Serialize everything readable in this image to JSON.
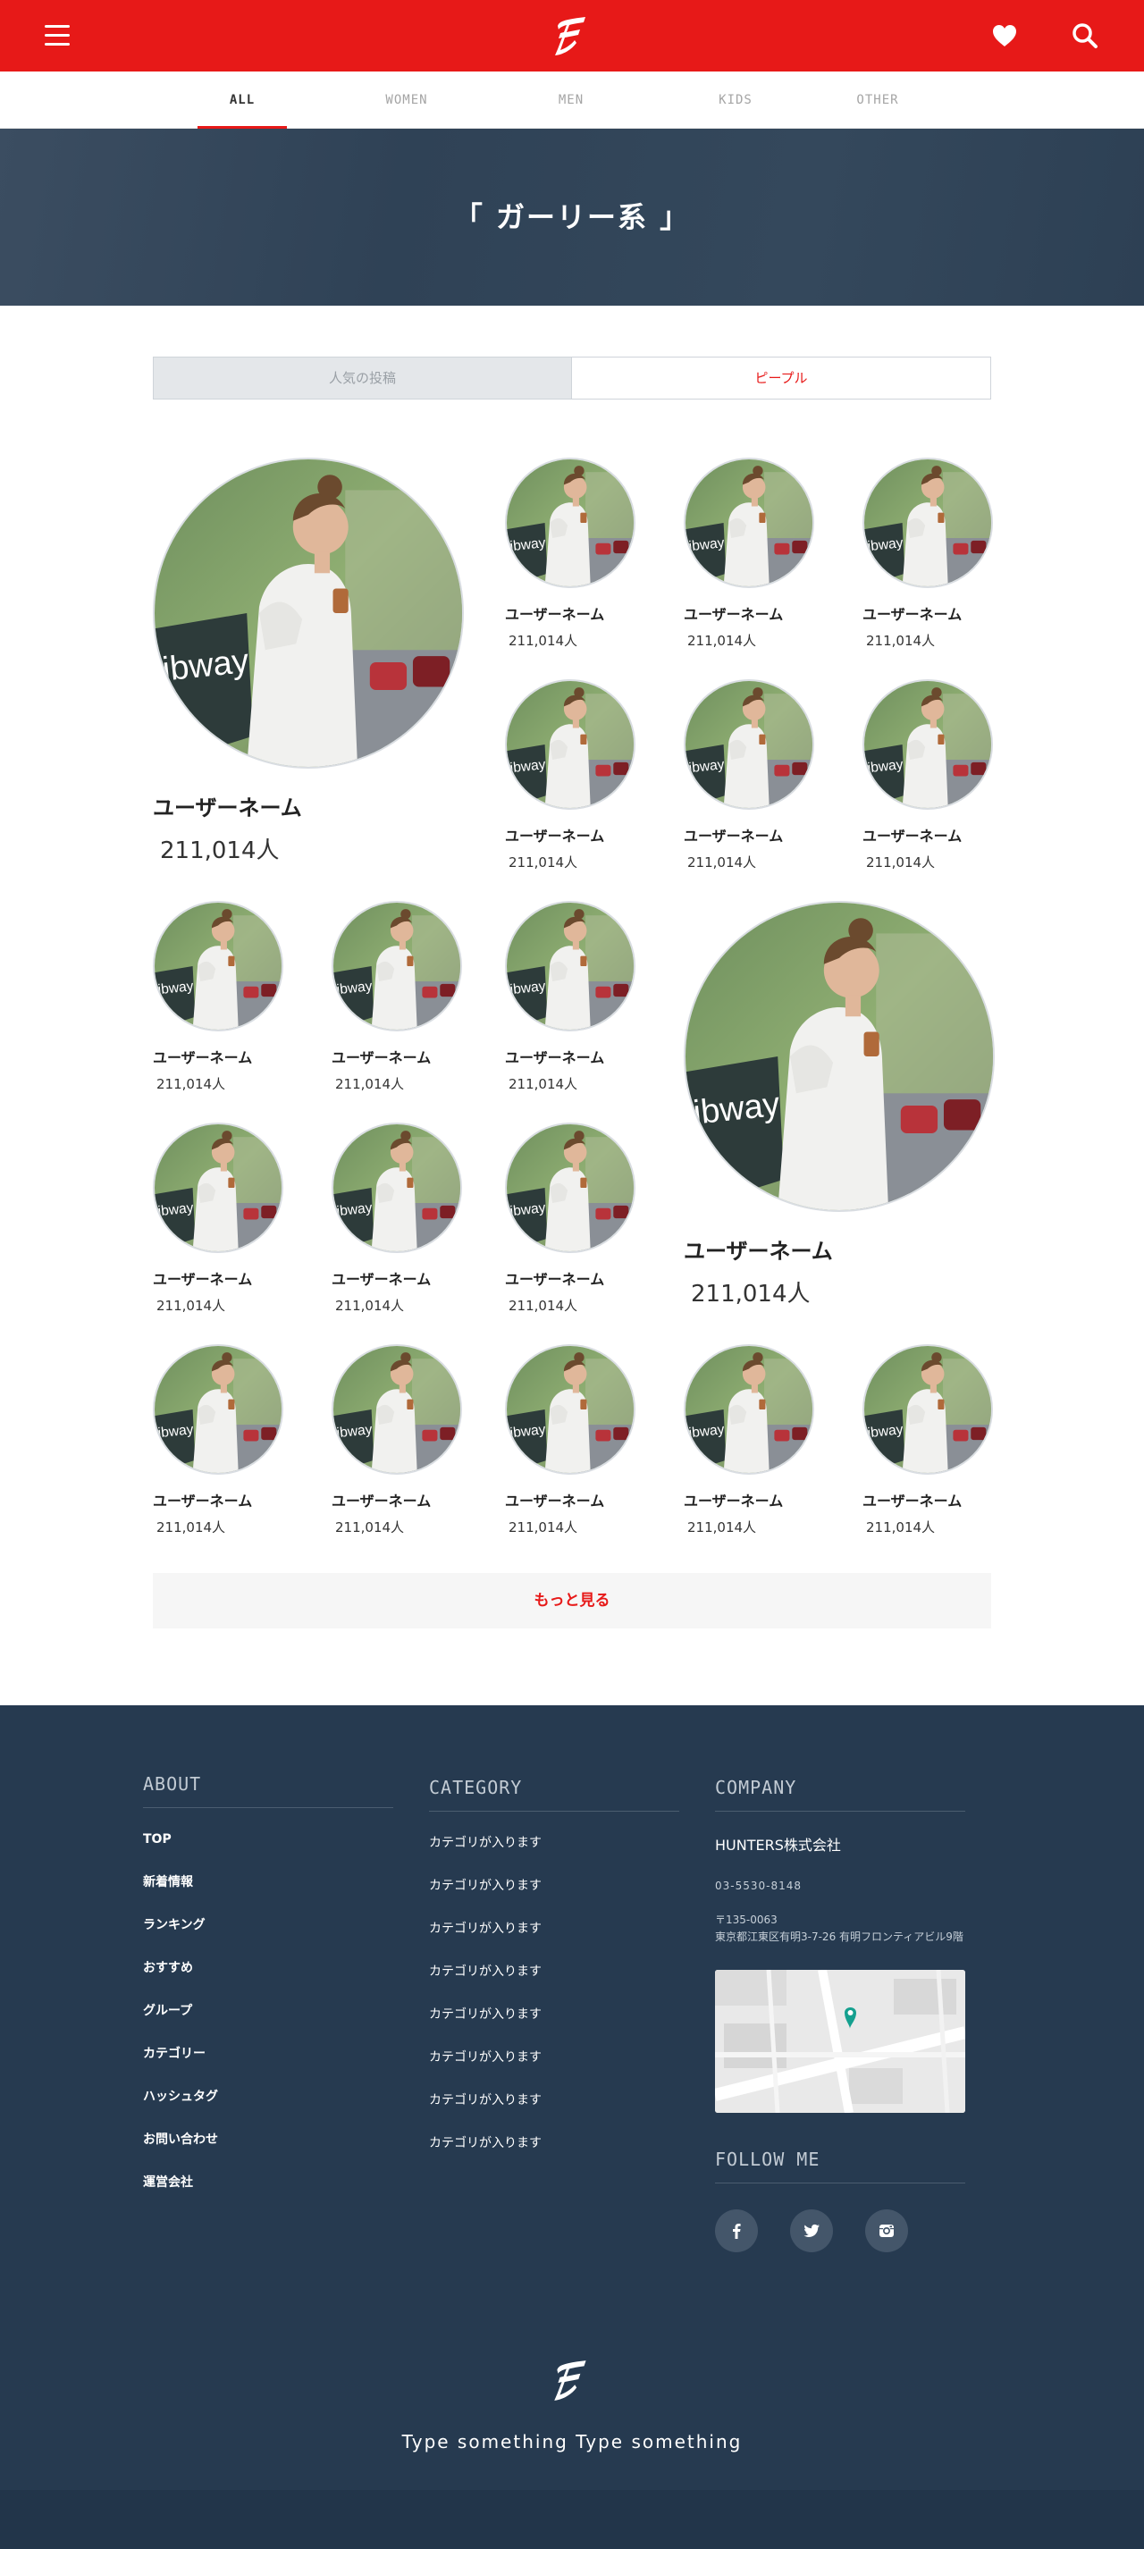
{
  "header": {
    "menu_icon": "hamburger-icon",
    "logo_icon": "brand-logo",
    "favorite_icon": "heart-icon",
    "search_icon": "search-icon",
    "accent_color": "#e71918"
  },
  "tabs": [
    {
      "label": "ALL",
      "active": true
    },
    {
      "label": "WOMEN",
      "active": false
    },
    {
      "label": "MEN",
      "active": false
    },
    {
      "label": "KIDS",
      "active": false
    },
    {
      "label": "OTHER",
      "active": false
    }
  ],
  "hero": {
    "title": "「 ガーリー系 」"
  },
  "switch": {
    "popular_label": "人気の投稿",
    "people_label": "ピープル",
    "active": "people"
  },
  "people": [
    {
      "name": "ユーザーネーム",
      "count": "211,014人",
      "size": "large"
    },
    {
      "name": "ユーザーネーム",
      "count": "211,014人",
      "size": "small"
    },
    {
      "name": "ユーザーネーム",
      "count": "211,014人",
      "size": "small"
    },
    {
      "name": "ユーザーネーム",
      "count": "211,014人",
      "size": "small"
    },
    {
      "name": "ユーザーネーム",
      "count": "211,014人",
      "size": "small"
    },
    {
      "name": "ユーザーネーム",
      "count": "211,014人",
      "size": "small"
    },
    {
      "name": "ユーザーネーム",
      "count": "211,014人",
      "size": "small"
    },
    {
      "name": "ユーザーネーム",
      "count": "211,014人",
      "size": "small"
    },
    {
      "name": "ユーザーネーム",
      "count": "211,014人",
      "size": "small"
    },
    {
      "name": "ユーザーネーム",
      "count": "211,014人",
      "size": "small"
    },
    {
      "name": "ユーザーネーム",
      "count": "211,014人",
      "size": "small"
    },
    {
      "name": "ユーザーネーム",
      "count": "211,014人",
      "size": "small"
    },
    {
      "name": "ユーザーネーム",
      "count": "211,014人",
      "size": "small"
    },
    {
      "name": "ユーザーネーム",
      "count": "211,014人",
      "size": "large"
    },
    {
      "name": "ユーザーネーム",
      "count": "211,014人",
      "size": "small"
    },
    {
      "name": "ユーザーネーム",
      "count": "211,014人",
      "size": "small"
    },
    {
      "name": "ユーザーネーム",
      "count": "211,014人",
      "size": "small"
    },
    {
      "name": "ユーザーネーム",
      "count": "211,014人",
      "size": "small"
    },
    {
      "name": "ユーザーネーム",
      "count": "211,014人",
      "size": "small"
    }
  ],
  "more_button": {
    "label": "もっと見る"
  },
  "footer": {
    "about": {
      "title": "ABOUT",
      "items": [
        "TOP",
        "新着情報",
        "ランキング",
        "おすすめ",
        "グループ",
        "カテゴリー",
        "ハッシュタグ",
        "お問い合わせ",
        "運営会社"
      ]
    },
    "category": {
      "title": "CATEGORY",
      "items": [
        "カテゴリが入ります",
        "カテゴリが入ります",
        "カテゴリが入ります",
        "カテゴリが入ります",
        "カテゴリが入ります",
        "カテゴリが入ります",
        "カテゴリが入ります",
        "カテゴリが入ります"
      ]
    },
    "company": {
      "title": "COMPANY",
      "name": "HUNTERS株式会社",
      "tel": "03-5530-8148",
      "zip": "〒135-0063",
      "address": "東京都江東区有明3-7-26 有明フロンティアビル9階"
    },
    "follow": {
      "title": "FOLLOW ME",
      "icons": [
        "facebook-icon",
        "twitter-icon",
        "instagram-icon"
      ]
    },
    "tagline": "Type something Type something"
  }
}
